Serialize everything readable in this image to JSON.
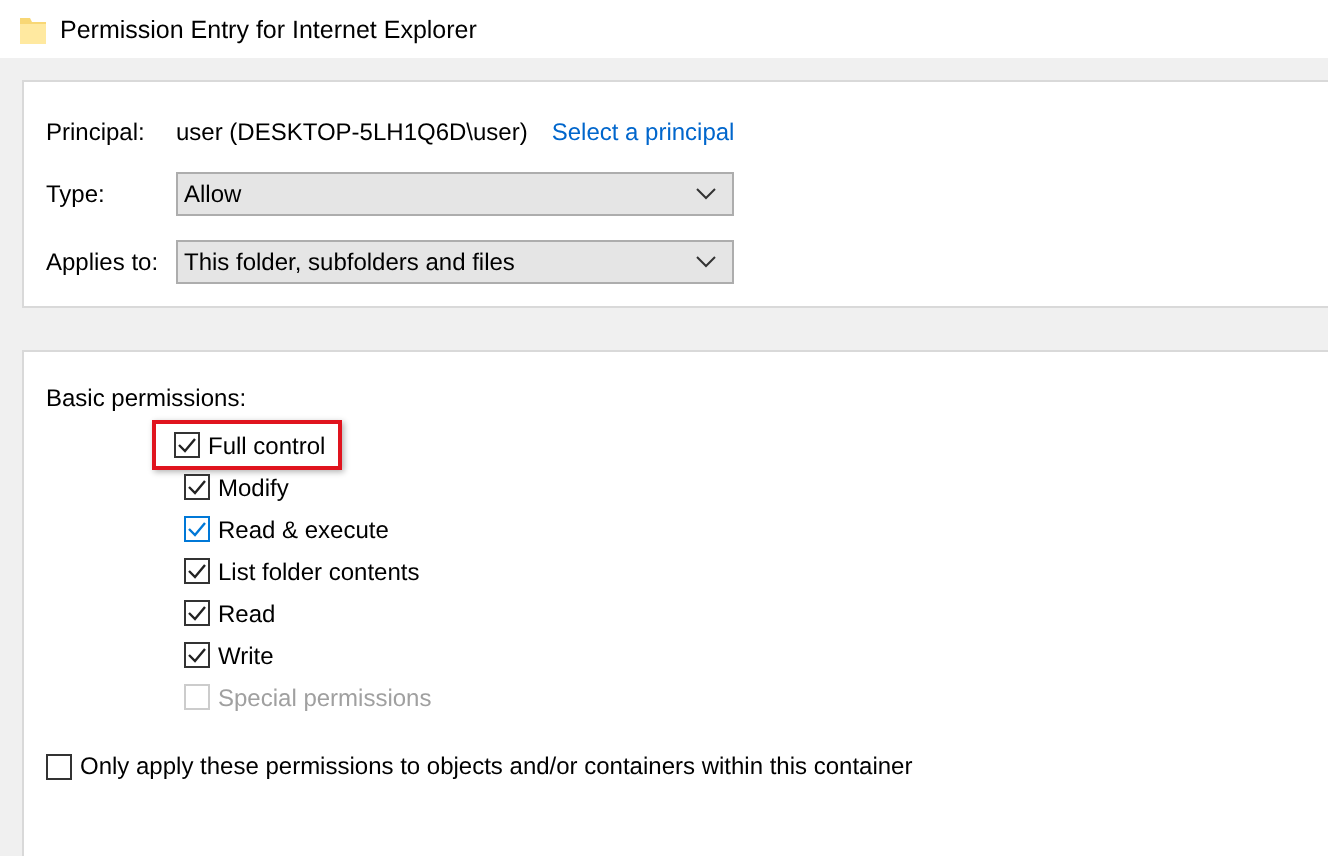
{
  "window": {
    "title": "Permission Entry for Internet Explorer"
  },
  "principal": {
    "label": "Principal:",
    "value": "user (DESKTOP-5LH1Q6D\\user)",
    "link": "Select a principal"
  },
  "fields": [
    {
      "label": "Type:",
      "value": "Allow"
    },
    {
      "label": "Applies to:",
      "value": "This folder, subfolders and files"
    }
  ],
  "basic_permissions": {
    "heading": "Basic permissions:",
    "items": [
      {
        "label": "Full control",
        "checked": true,
        "disabled": false,
        "hover": false,
        "highlighted": true
      },
      {
        "label": "Modify",
        "checked": true,
        "disabled": false,
        "hover": false,
        "highlighted": false
      },
      {
        "label": "Read & execute",
        "checked": true,
        "disabled": false,
        "hover": true,
        "highlighted": false
      },
      {
        "label": "List folder contents",
        "checked": true,
        "disabled": false,
        "hover": false,
        "highlighted": false
      },
      {
        "label": "Read",
        "checked": true,
        "disabled": false,
        "hover": false,
        "highlighted": false
      },
      {
        "label": "Write",
        "checked": true,
        "disabled": false,
        "hover": false,
        "highlighted": false
      },
      {
        "label": "Special permissions",
        "checked": false,
        "disabled": true,
        "hover": false,
        "highlighted": false
      }
    ]
  },
  "only_apply": {
    "label": "Only apply these permissions to objects and/or containers within this container",
    "checked": false
  }
}
